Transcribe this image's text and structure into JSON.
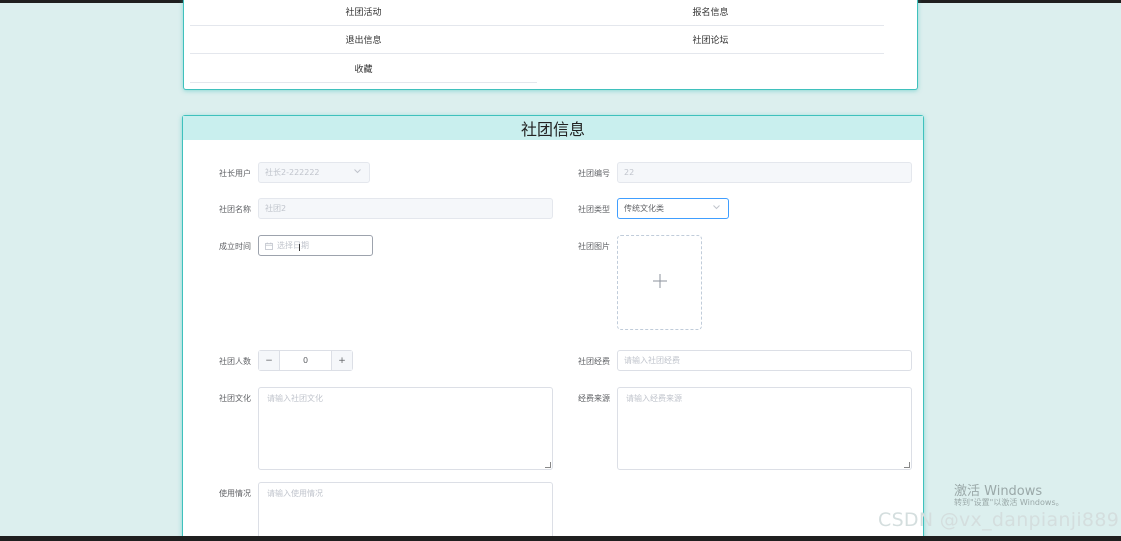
{
  "nav": {
    "items": [
      "社团活动",
      "报名信息",
      "退出信息",
      "社团论坛",
      "收藏"
    ]
  },
  "form": {
    "title": "社团信息",
    "president_label": "社长用户",
    "president_value": "社长2-222222",
    "club_no_label": "社团编号",
    "club_no_value": "22",
    "club_name_label": "社团名称",
    "club_name_value": "社团2",
    "club_type_label": "社团类型",
    "club_type_value": "传统文化类",
    "founded_label": "成立时间",
    "founded_placeholder": "选择日期",
    "image_label": "社团图片",
    "members_label": "社团人数",
    "members_value": "0",
    "funds_label": "社团经费",
    "funds_placeholder": "请输入社团经费",
    "culture_label": "社团文化",
    "culture_placeholder": "请输入社团文化",
    "source_label": "经费来源",
    "source_placeholder": "请输入经费来源",
    "usage_label": "使用情况",
    "usage_placeholder": "请输入使用情况"
  },
  "overlay": {
    "win_activate": "激活 Windows",
    "win_activate_sub": "转到\"设置\"以激活 Windows。",
    "csdn": "CSDN @vx_danpianji889"
  },
  "colors": {
    "accent": "#3fc1bd",
    "header_bg": "#c9efee",
    "page_bg": "#dcefee",
    "focus": "#409eff"
  }
}
